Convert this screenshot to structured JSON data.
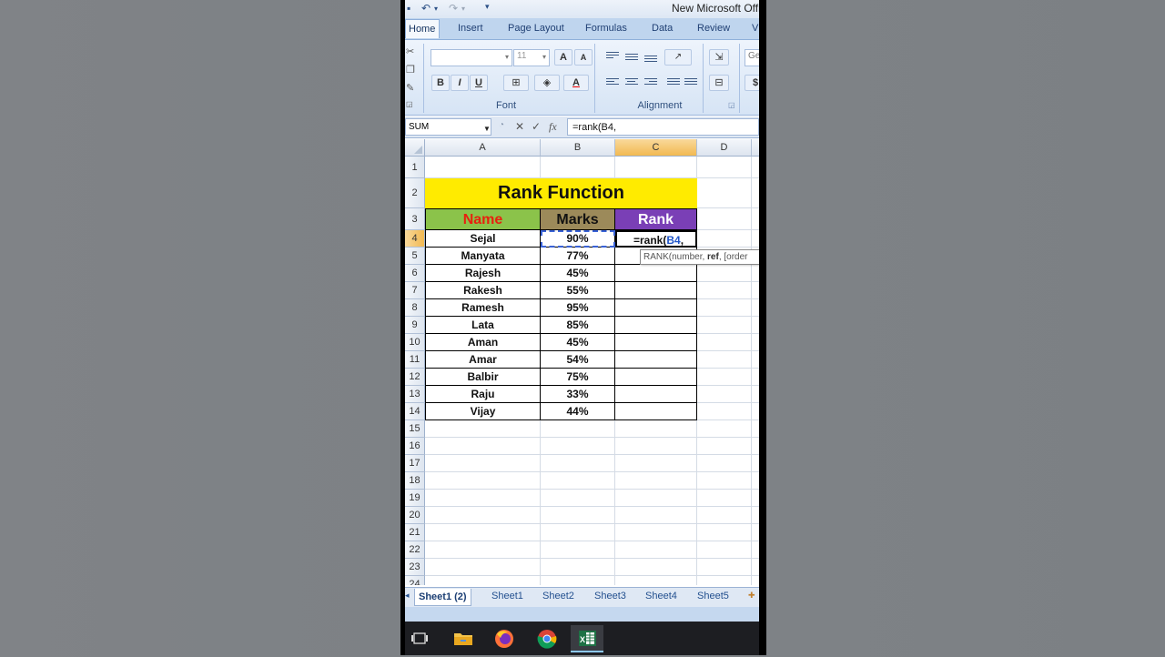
{
  "window": {
    "title": "New Microsoft Offi"
  },
  "ribbon": {
    "tabs": [
      "Home",
      "Insert",
      "Page Layout",
      "Formulas",
      "Data",
      "Review",
      "V"
    ],
    "font_size": "11",
    "styles_partial": "Ge",
    "group_font": "Font",
    "group_alignment": "Alignment",
    "bold_glyph": "B",
    "italic_glyph": "I",
    "underline_glyph": "U",
    "grow_glyph": "A",
    "shrink_glyph": "A",
    "fontcolor_glyph": "A",
    "currency_glyph": "$"
  },
  "formula_bar": {
    "name_box": "SUM",
    "formula": "=rank(B4,",
    "cancel_glyph": "✕",
    "enter_glyph": "✓",
    "fx_glyph": "fx"
  },
  "sheet": {
    "columns": [
      "A",
      "B",
      "C",
      "D"
    ],
    "selected_column": "C",
    "selected_row": "4",
    "title": "Rank Function",
    "headers": {
      "name": "Name",
      "marks": "Marks",
      "rank": "Rank"
    },
    "colors": {
      "title_bg": "#ffeb00",
      "name_bg": "#8bc34a",
      "name_fg": "#e8210e",
      "marks_bg": "#9c8a5a",
      "rank_bg": "#7a3fb6",
      "rank_fg": "#ffffff"
    },
    "rows": [
      {
        "name": "Sejal",
        "marks": "90%"
      },
      {
        "name": "Manyata",
        "marks": "77%"
      },
      {
        "name": "Rajesh",
        "marks": "45%"
      },
      {
        "name": "Rakesh",
        "marks": "55%"
      },
      {
        "name": "Ramesh",
        "marks": "95%"
      },
      {
        "name": "Lata",
        "marks": "85%"
      },
      {
        "name": "Aman",
        "marks": "45%"
      },
      {
        "name": "Amar",
        "marks": "54%"
      },
      {
        "name": "Balbir",
        "marks": "75%"
      },
      {
        "name": "Raju",
        "marks": "33%"
      },
      {
        "name": "Vijay",
        "marks": "44%"
      }
    ],
    "active_cell_text_prefix": "=rank(",
    "active_cell_ref": "B4",
    "active_cell_text_suffix": ",",
    "row_numbers": [
      "1",
      "2",
      "3",
      "4",
      "5",
      "6",
      "7",
      "8",
      "9",
      "10",
      "11",
      "12",
      "13",
      "14",
      "15",
      "16",
      "17",
      "18",
      "19",
      "20",
      "21",
      "22",
      "23",
      "24"
    ],
    "tooltip": {
      "fn": "RANK(number, ",
      "bold": "ref",
      "rest": ", [order"
    }
  },
  "sheet_tabs": [
    "Sheet1 (2)",
    "Sheet1",
    "Sheet2",
    "Sheet3",
    "Sheet4",
    "Sheet5"
  ],
  "taskbar": [
    "task-view-icon",
    "file-explorer-icon",
    "firefox-icon",
    "chrome-icon",
    "excel-icon"
  ]
}
